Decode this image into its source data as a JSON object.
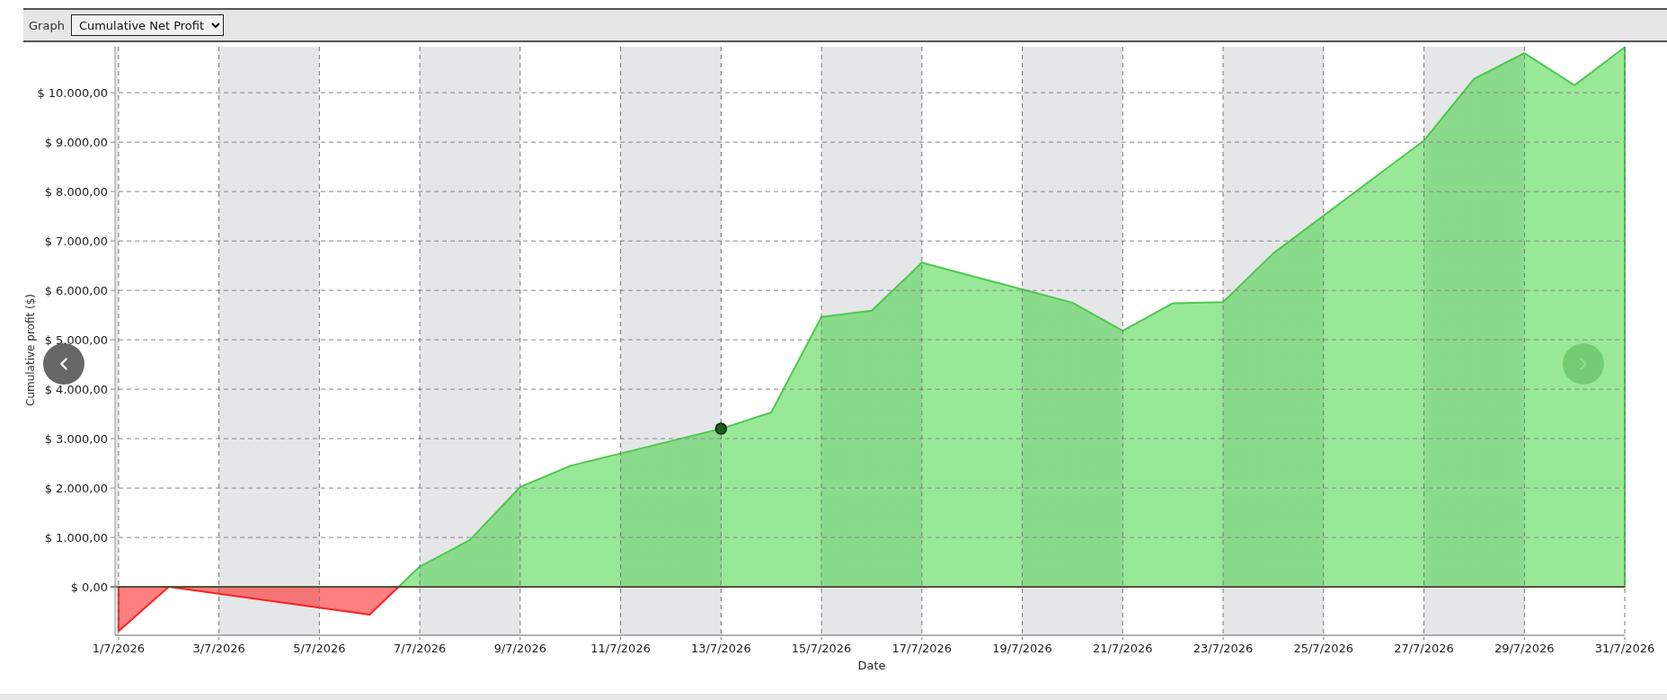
{
  "toolbar": {
    "label": "Graph",
    "select": {
      "value": "Cumulative Net Profit"
    }
  },
  "chart": {
    "chart_data": {
      "type": "area",
      "xlabel": "Date",
      "ylabel": "Cumulative profit ($)",
      "grid": true,
      "categories": [
        "1/7/2026",
        null,
        "3/7/2026",
        null,
        "5/7/2026",
        null,
        "7/7/2026",
        null,
        "9/7/2026",
        null,
        "11/7/2026",
        null,
        "13/7/2026",
        null,
        "15/7/2026",
        null,
        "17/7/2026",
        null,
        "19/7/2026",
        null,
        "21/7/2026",
        null,
        "23/7/2026",
        null,
        "25/7/2026",
        null,
        "27/7/2026",
        null,
        "29/7/2026",
        null,
        "31/7/2026"
      ],
      "series": [
        {
          "color": "#4cc94c",
          "values": [
            -900,
            0,
            -140,
            -280,
            -420,
            -560,
            410,
            950,
            2020,
            2450,
            2700,
            2950,
            3200,
            3530,
            5460,
            5590,
            6560,
            6290,
            6020,
            5750,
            5180,
            5740,
            5760,
            6750,
            7510,
            8270,
            9030,
            10280,
            10800,
            10150,
            10920
          ]
        }
      ],
      "ylim": [
        -980,
        10930
      ],
      "yticks": [
        {
          "value": 0,
          "label": "$ 0,00"
        },
        {
          "value": 1000,
          "label": "$ 1.000,00"
        },
        {
          "value": 2000,
          "label": "$ 2.000,00"
        },
        {
          "value": 3000,
          "label": "$ 3.000,00"
        },
        {
          "value": 4000,
          "label": "$ 4.000,00"
        },
        {
          "value": 5000,
          "label": "$ 5.000,00"
        },
        {
          "value": 6000,
          "label": "$ 6.000,00"
        },
        {
          "value": 7000,
          "label": "$ 7.000,00"
        },
        {
          "value": 8000,
          "label": "$ 8.000,00"
        },
        {
          "value": 9000,
          "label": "$ 9.000,00"
        },
        {
          "value": 10000,
          "label": "$ 10.000,00"
        }
      ],
      "annotations": [
        {
          "x": "13/7/2026"
        }
      ]
    }
  }
}
